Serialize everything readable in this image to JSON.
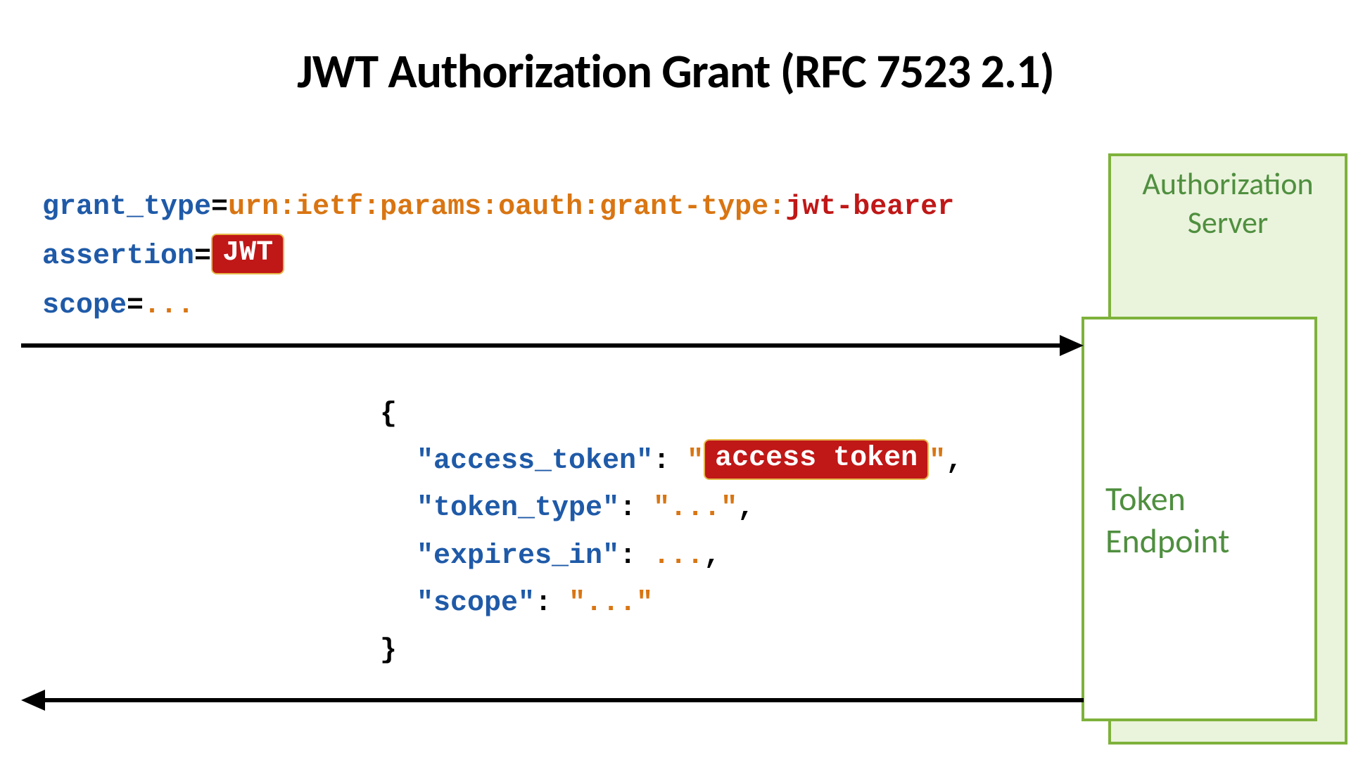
{
  "title": "JWT Authorization Grant (RFC 7523 2.1)",
  "server": {
    "auth_label_line1": "Authorization",
    "auth_label_line2": "Server",
    "token_label_line1": "Token",
    "token_label_line2": "Endpoint"
  },
  "request": {
    "grant_type_key": "grant_type",
    "eq": "=",
    "grant_type_prefix": "urn:ietf:params:oauth:grant-type:",
    "grant_type_suffix": "jwt-bearer",
    "assertion_key": "assertion",
    "assertion_pill": "JWT",
    "scope_key": "scope",
    "scope_value": "..."
  },
  "response": {
    "open_brace": "{",
    "close_brace": "}",
    "quote": "\"",
    "colon": ":",
    "comma": ",",
    "access_token_key": "access_token",
    "access_token_pill": "access token",
    "token_type_key": "token_type",
    "token_type_value": "...",
    "expires_in_key": "expires_in",
    "expires_in_value": "...",
    "scope_key": "scope",
    "scope_value": "..."
  }
}
